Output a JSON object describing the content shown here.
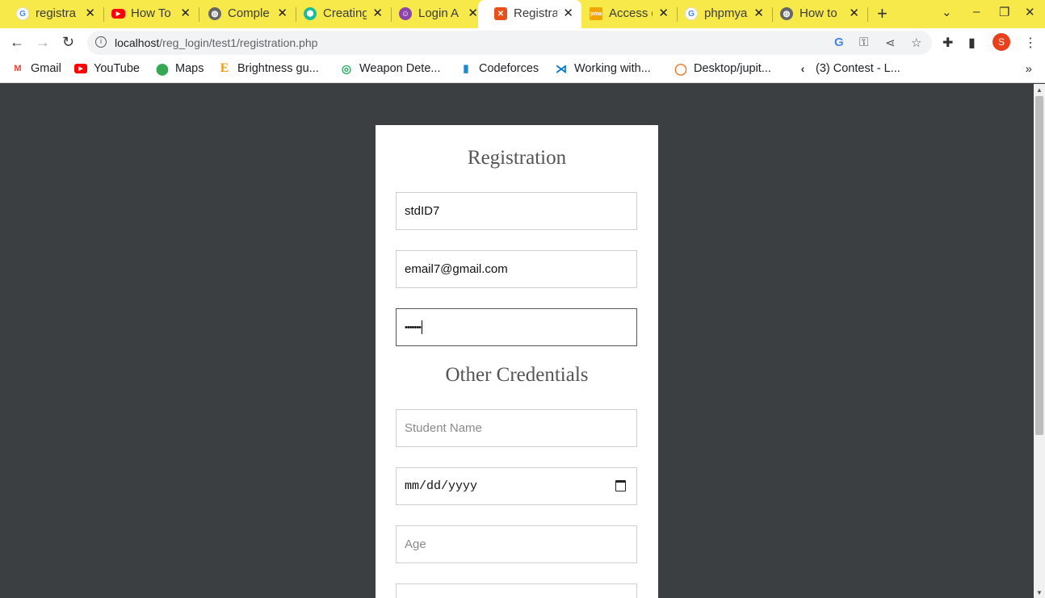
{
  "browser": {
    "tabs": [
      {
        "label": "registra",
        "icon": "google-icon",
        "icon_color": "#4285f4",
        "active": false
      },
      {
        "label": "How To",
        "icon": "youtube-icon",
        "icon_color": "#ff0000",
        "active": false
      },
      {
        "label": "Comple",
        "icon": "globe-icon",
        "icon_color": "#666666",
        "active": false
      },
      {
        "label": "Creating",
        "icon": "hexagon-icon",
        "icon_color": "#1abc9c",
        "active": false
      },
      {
        "label": "Login A",
        "icon": "avatar-icon",
        "icon_color": "#8e44ad",
        "active": false
      },
      {
        "label": "Registra",
        "icon": "xampp-icon",
        "icon_color": "#e8501a",
        "active": true
      },
      {
        "label": "Access d",
        "icon": "phpmyadmin-icon",
        "icon_color": "#f0a500",
        "active": false
      },
      {
        "label": "phpmya",
        "icon": "google-icon",
        "icon_color": "#4285f4",
        "active": false
      },
      {
        "label": "How to",
        "icon": "globe-icon",
        "icon_color": "#666666",
        "active": false
      }
    ],
    "url_host": "localhost",
    "url_path": "/reg_login/test1/registration.php",
    "profile_initial": "S",
    "bookmarks": [
      {
        "label": "Gmail",
        "icon": "gmail-icon",
        "icon_color": "#ea4335"
      },
      {
        "label": "YouTube",
        "icon": "youtube-icon",
        "icon_color": "#ff0000"
      },
      {
        "label": "Maps",
        "icon": "maps-icon",
        "icon_color": "#34a853"
      },
      {
        "label": "Brightness gu...",
        "icon": "e-icon",
        "icon_color": "#f39c12"
      },
      {
        "label": "Weapon Dete...",
        "icon": "roboflow-icon",
        "icon_color": "#27ae60"
      },
      {
        "label": "Codeforces",
        "icon": "codeforces-icon",
        "icon_color": "#1f8acb"
      },
      {
        "label": "Working with...",
        "icon": "vscode-icon",
        "icon_color": "#007acc"
      },
      {
        "label": "Desktop/jupit...",
        "icon": "jupyter-icon",
        "icon_color": "#f37626"
      },
      {
        "label": "(3) Contest - L...",
        "icon": "leetcode-icon",
        "icon_color": "#333333"
      }
    ]
  },
  "form": {
    "title": "Registration",
    "student_id_value": "stdID7",
    "email_value": "email7@gmail.com",
    "password_masked": "•••••••",
    "section_title": "Other Credentials",
    "student_name_placeholder": "Student Name",
    "dob_placeholder": "mm/dd/yyyy",
    "age_placeholder": "Age"
  }
}
